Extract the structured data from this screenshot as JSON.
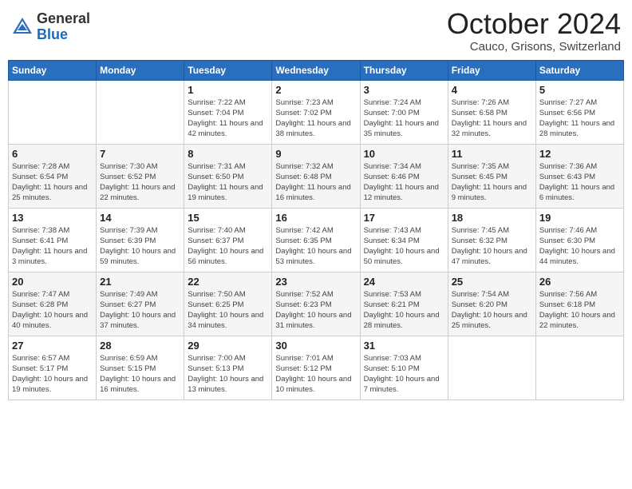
{
  "header": {
    "logo_general": "General",
    "logo_blue": "Blue",
    "title": "October 2024",
    "location": "Cauco, Grisons, Switzerland"
  },
  "days_of_week": [
    "Sunday",
    "Monday",
    "Tuesday",
    "Wednesday",
    "Thursday",
    "Friday",
    "Saturday"
  ],
  "weeks": [
    [
      {
        "day": "",
        "info": ""
      },
      {
        "day": "",
        "info": ""
      },
      {
        "day": "1",
        "info": "Sunrise: 7:22 AM\nSunset: 7:04 PM\nDaylight: 11 hours and 42 minutes."
      },
      {
        "day": "2",
        "info": "Sunrise: 7:23 AM\nSunset: 7:02 PM\nDaylight: 11 hours and 38 minutes."
      },
      {
        "day": "3",
        "info": "Sunrise: 7:24 AM\nSunset: 7:00 PM\nDaylight: 11 hours and 35 minutes."
      },
      {
        "day": "4",
        "info": "Sunrise: 7:26 AM\nSunset: 6:58 PM\nDaylight: 11 hours and 32 minutes."
      },
      {
        "day": "5",
        "info": "Sunrise: 7:27 AM\nSunset: 6:56 PM\nDaylight: 11 hours and 28 minutes."
      }
    ],
    [
      {
        "day": "6",
        "info": "Sunrise: 7:28 AM\nSunset: 6:54 PM\nDaylight: 11 hours and 25 minutes."
      },
      {
        "day": "7",
        "info": "Sunrise: 7:30 AM\nSunset: 6:52 PM\nDaylight: 11 hours and 22 minutes."
      },
      {
        "day": "8",
        "info": "Sunrise: 7:31 AM\nSunset: 6:50 PM\nDaylight: 11 hours and 19 minutes."
      },
      {
        "day": "9",
        "info": "Sunrise: 7:32 AM\nSunset: 6:48 PM\nDaylight: 11 hours and 16 minutes."
      },
      {
        "day": "10",
        "info": "Sunrise: 7:34 AM\nSunset: 6:46 PM\nDaylight: 11 hours and 12 minutes."
      },
      {
        "day": "11",
        "info": "Sunrise: 7:35 AM\nSunset: 6:45 PM\nDaylight: 11 hours and 9 minutes."
      },
      {
        "day": "12",
        "info": "Sunrise: 7:36 AM\nSunset: 6:43 PM\nDaylight: 11 hours and 6 minutes."
      }
    ],
    [
      {
        "day": "13",
        "info": "Sunrise: 7:38 AM\nSunset: 6:41 PM\nDaylight: 11 hours and 3 minutes."
      },
      {
        "day": "14",
        "info": "Sunrise: 7:39 AM\nSunset: 6:39 PM\nDaylight: 10 hours and 59 minutes."
      },
      {
        "day": "15",
        "info": "Sunrise: 7:40 AM\nSunset: 6:37 PM\nDaylight: 10 hours and 56 minutes."
      },
      {
        "day": "16",
        "info": "Sunrise: 7:42 AM\nSunset: 6:35 PM\nDaylight: 10 hours and 53 minutes."
      },
      {
        "day": "17",
        "info": "Sunrise: 7:43 AM\nSunset: 6:34 PM\nDaylight: 10 hours and 50 minutes."
      },
      {
        "day": "18",
        "info": "Sunrise: 7:45 AM\nSunset: 6:32 PM\nDaylight: 10 hours and 47 minutes."
      },
      {
        "day": "19",
        "info": "Sunrise: 7:46 AM\nSunset: 6:30 PM\nDaylight: 10 hours and 44 minutes."
      }
    ],
    [
      {
        "day": "20",
        "info": "Sunrise: 7:47 AM\nSunset: 6:28 PM\nDaylight: 10 hours and 40 minutes."
      },
      {
        "day": "21",
        "info": "Sunrise: 7:49 AM\nSunset: 6:27 PM\nDaylight: 10 hours and 37 minutes."
      },
      {
        "day": "22",
        "info": "Sunrise: 7:50 AM\nSunset: 6:25 PM\nDaylight: 10 hours and 34 minutes."
      },
      {
        "day": "23",
        "info": "Sunrise: 7:52 AM\nSunset: 6:23 PM\nDaylight: 10 hours and 31 minutes."
      },
      {
        "day": "24",
        "info": "Sunrise: 7:53 AM\nSunset: 6:21 PM\nDaylight: 10 hours and 28 minutes."
      },
      {
        "day": "25",
        "info": "Sunrise: 7:54 AM\nSunset: 6:20 PM\nDaylight: 10 hours and 25 minutes."
      },
      {
        "day": "26",
        "info": "Sunrise: 7:56 AM\nSunset: 6:18 PM\nDaylight: 10 hours and 22 minutes."
      }
    ],
    [
      {
        "day": "27",
        "info": "Sunrise: 6:57 AM\nSunset: 5:17 PM\nDaylight: 10 hours and 19 minutes."
      },
      {
        "day": "28",
        "info": "Sunrise: 6:59 AM\nSunset: 5:15 PM\nDaylight: 10 hours and 16 minutes."
      },
      {
        "day": "29",
        "info": "Sunrise: 7:00 AM\nSunset: 5:13 PM\nDaylight: 10 hours and 13 minutes."
      },
      {
        "day": "30",
        "info": "Sunrise: 7:01 AM\nSunset: 5:12 PM\nDaylight: 10 hours and 10 minutes."
      },
      {
        "day": "31",
        "info": "Sunrise: 7:03 AM\nSunset: 5:10 PM\nDaylight: 10 hours and 7 minutes."
      },
      {
        "day": "",
        "info": ""
      },
      {
        "day": "",
        "info": ""
      }
    ]
  ]
}
